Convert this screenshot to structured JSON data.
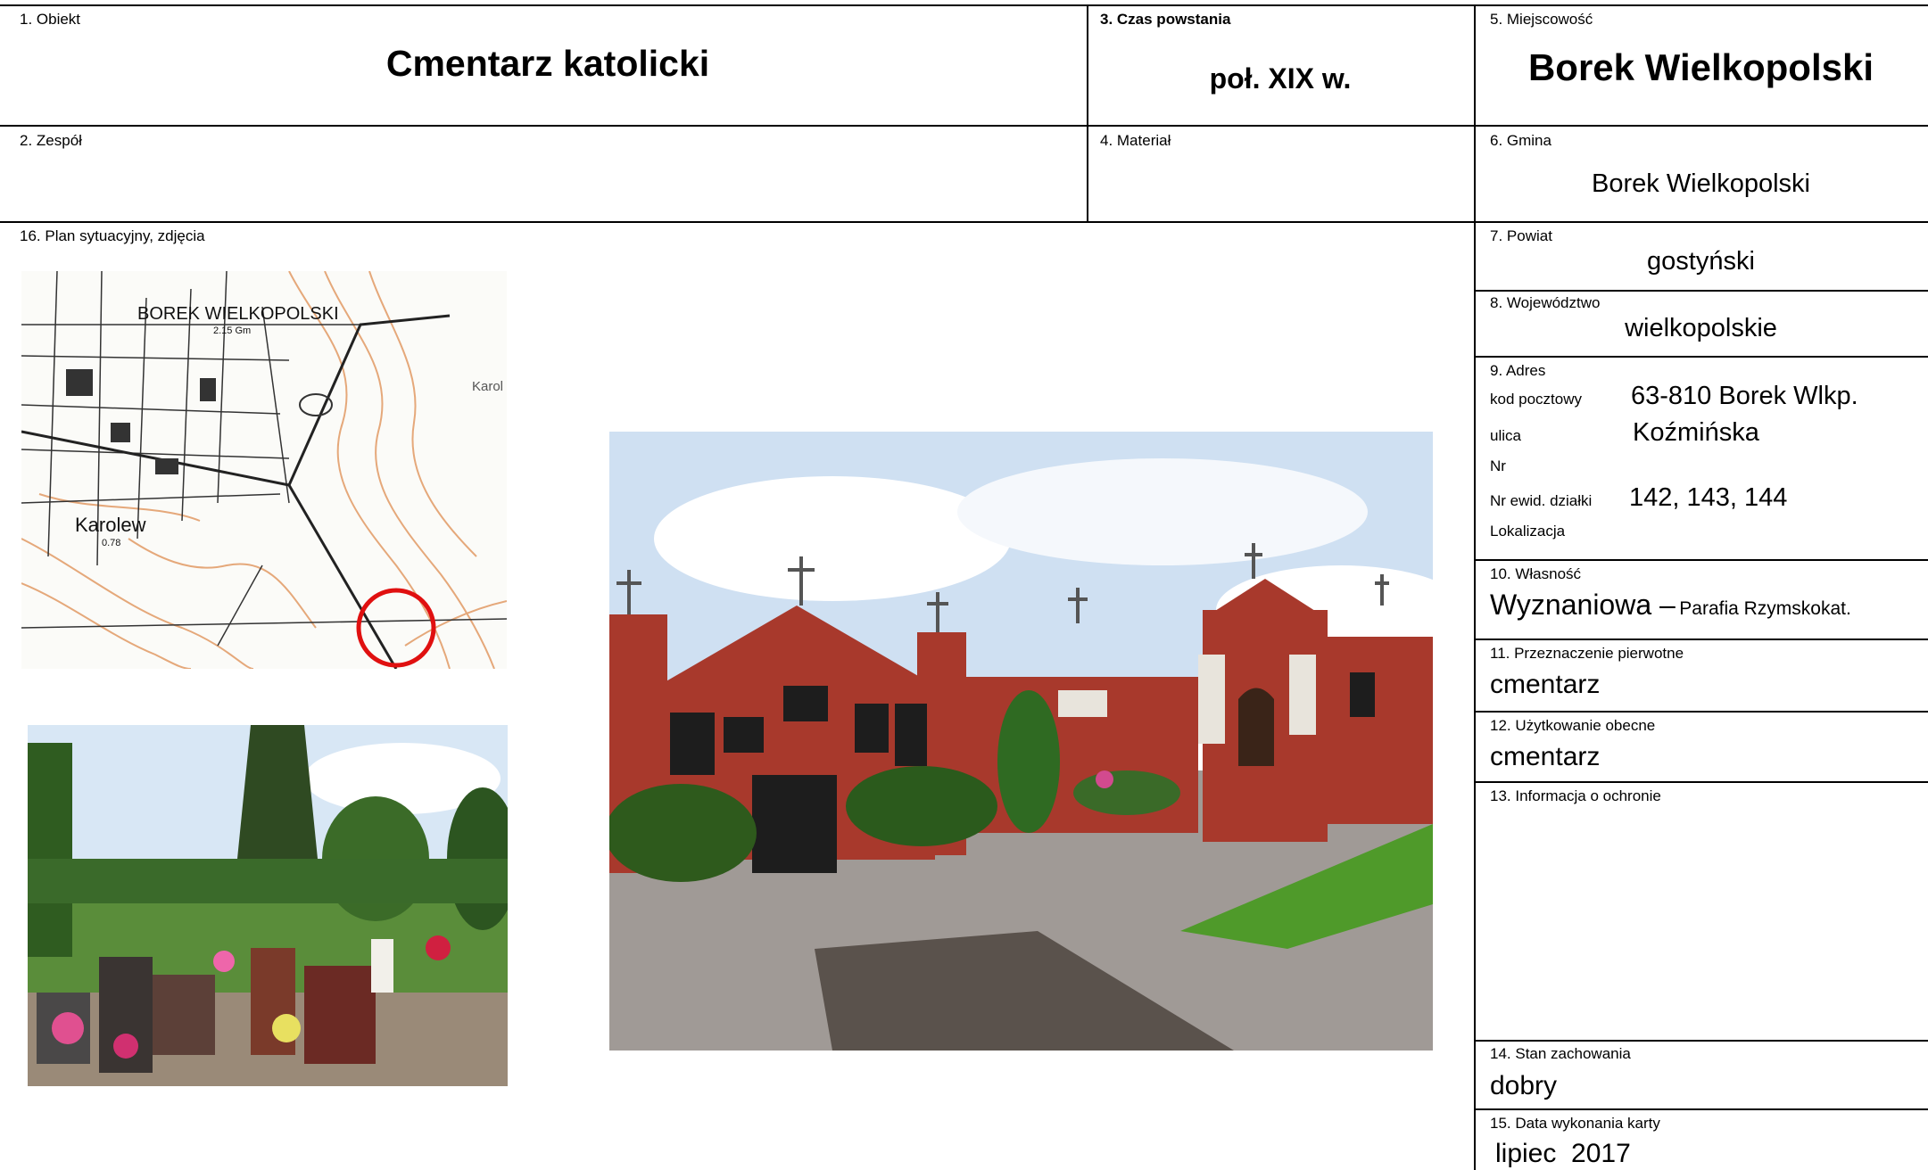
{
  "card": {
    "f1_label": "1. Obiekt",
    "f1_value": "Cmentarz katolicki",
    "f2_label": "2. Zespół",
    "f3_label": "3. Czas powstania",
    "f3_value": "poł. XIX w.",
    "f4_label": "4. Materiał",
    "f5_label": "5. Miejscowość",
    "f5_value": "Borek Wielkopolski",
    "f6_label": "6. Gmina",
    "f6_value": "Borek Wielkopolski",
    "f7_label": "7. Powiat",
    "f7_value": "gostyński",
    "f8_label": "8. Województwo",
    "f8_value": "wielkopolskie",
    "f9_label": "9. Adres",
    "f9_postal_label": "kod pocztowy",
    "f9_postal_value": "63-810 Borek Wlkp.",
    "f9_street_label": "ulica",
    "f9_street_value": "Koźmińska",
    "f9_nr_label": "Nr",
    "f9_plot_label": "Nr ewid. działki",
    "f9_plot_value": "142, 143, 144",
    "f9_loc_label": "Lokalizacja",
    "f10_label": "10. Własność",
    "f10_value": "Wyznaniowa –",
    "f10_sub": "Parafia Rzymskokat.",
    "f11_label": "11. Przeznaczenie pierwotne",
    "f11_value": "cmentarz",
    "f12_label": "12. Użytkowanie obecne",
    "f12_value": "cmentarz",
    "f13_label": "13. Informacja o ochronie",
    "f14_label": "14. Stan zachowania",
    "f14_value": "dobry",
    "f15_label": "15. Data wykonania karty",
    "f15_value": "lipiec  2017",
    "f16_label": "16. Plan sytuacyjny, zdjęcia"
  },
  "map": {
    "town_label": "BOREK WIELKOPOLSKI",
    "height_label": "2.15 Gm",
    "village_label": "Karolew",
    "village_sub": "0.78",
    "edge_label": "Karol"
  },
  "colors": {
    "contour": "#e0a070",
    "marker": "#e01010",
    "brick": "#a8392c",
    "sky": "#cfe0f2",
    "grass": "#4f9a2a"
  }
}
